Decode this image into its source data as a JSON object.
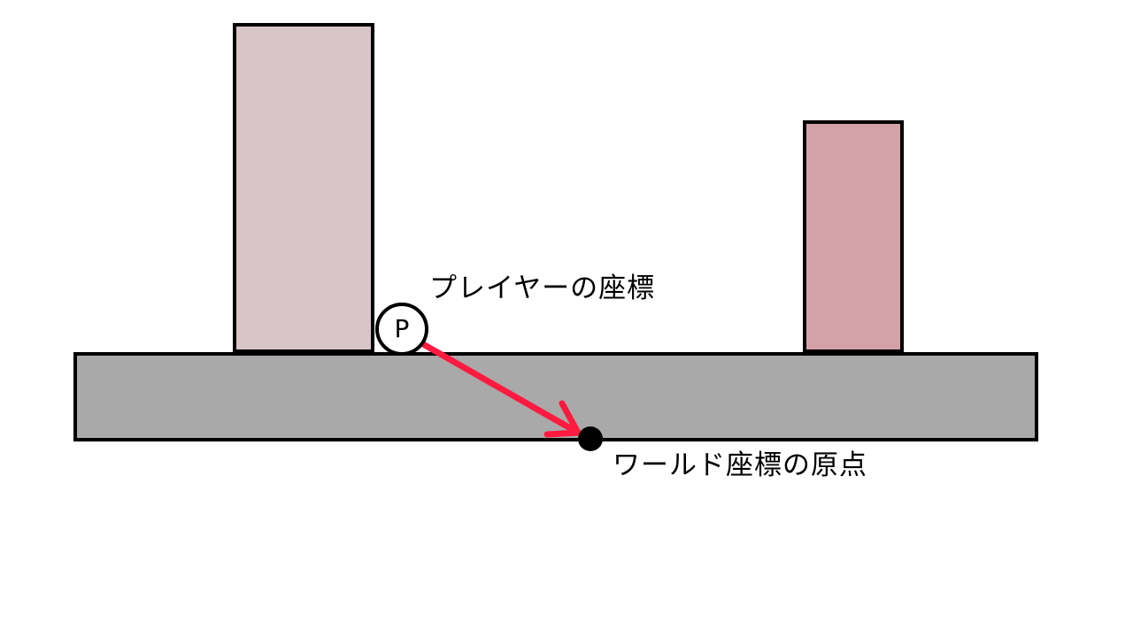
{
  "diagram": {
    "player_marker": {
      "letter": "P",
      "label": "プレイヤーの座標"
    },
    "world_origin": {
      "label": "ワールド座標の原点"
    },
    "colors": {
      "ground": "#a9a9a9",
      "left_block": "#d9c5c7",
      "right_block": "#d4a1a8",
      "arrow": "#ff1a3f",
      "outline": "#000000",
      "origin_dot": "#000000",
      "background": "#ffffff"
    },
    "icons": {
      "player": "player-circle",
      "origin": "dot"
    }
  }
}
